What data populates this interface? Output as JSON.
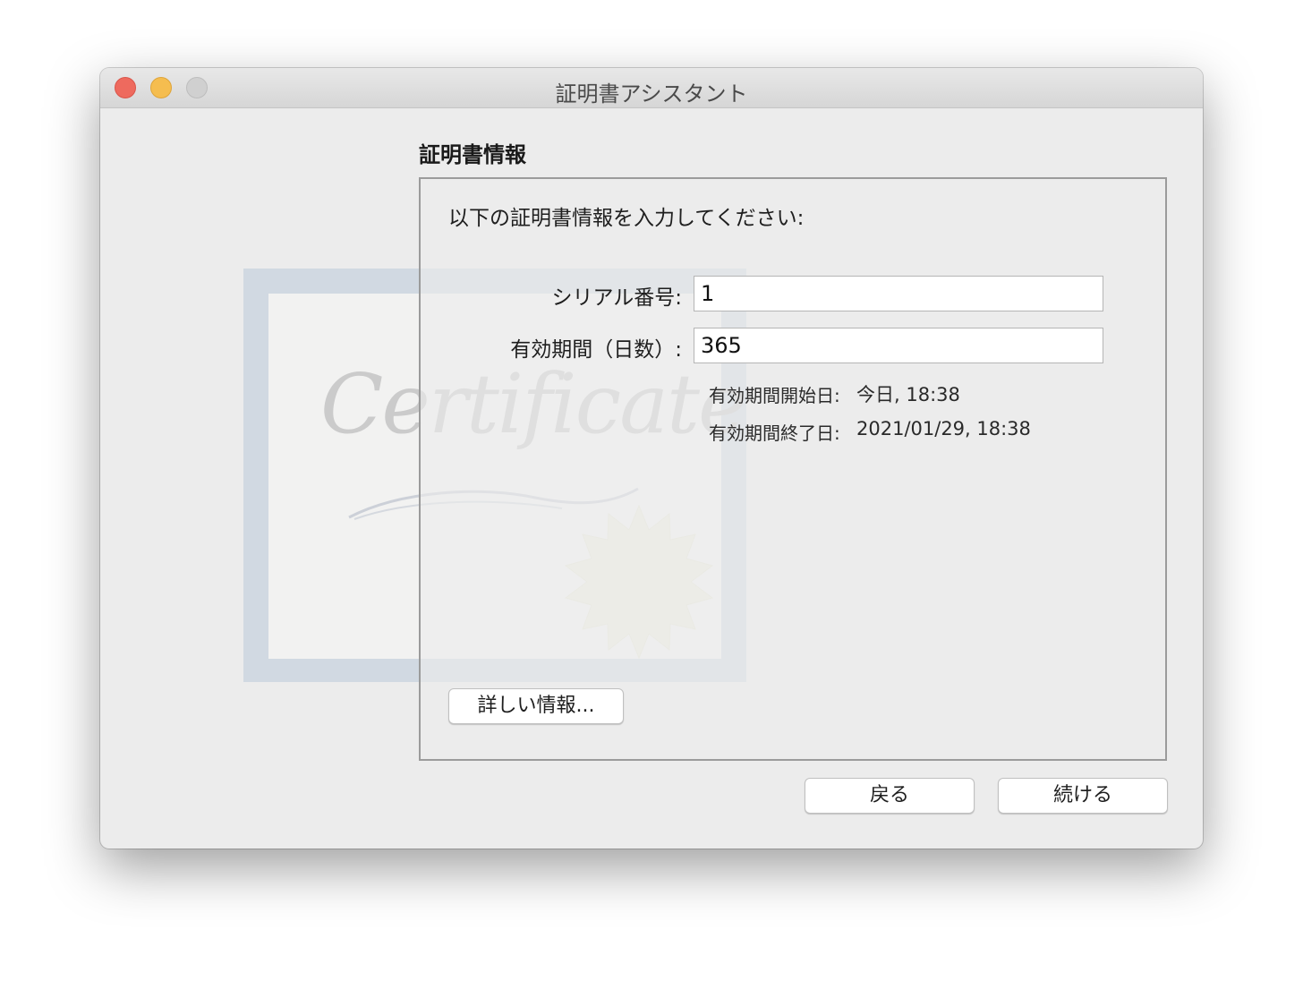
{
  "window": {
    "title": "証明書アシスタント"
  },
  "section": {
    "title": "証明書情報"
  },
  "form": {
    "instructions": "以下の証明書情報を入力してください:",
    "serial_label": "シリアル番号:",
    "serial_value": "1",
    "validity_label": "有効期間（日数）:",
    "validity_value": "365",
    "start_label": "有効期間開始日:",
    "start_value": "今日, 18:38",
    "end_label": "有効期間終了日:",
    "end_value": "2021/01/29, 18:38",
    "more_info_label": "詳しい情報..."
  },
  "footer": {
    "back_label": "戻る",
    "continue_label": "続ける"
  },
  "colors": {
    "close": "#ee6a5e",
    "minimize": "#f5bd4f",
    "zoom": "#d0d0d0",
    "window_bg": "#ececec"
  }
}
